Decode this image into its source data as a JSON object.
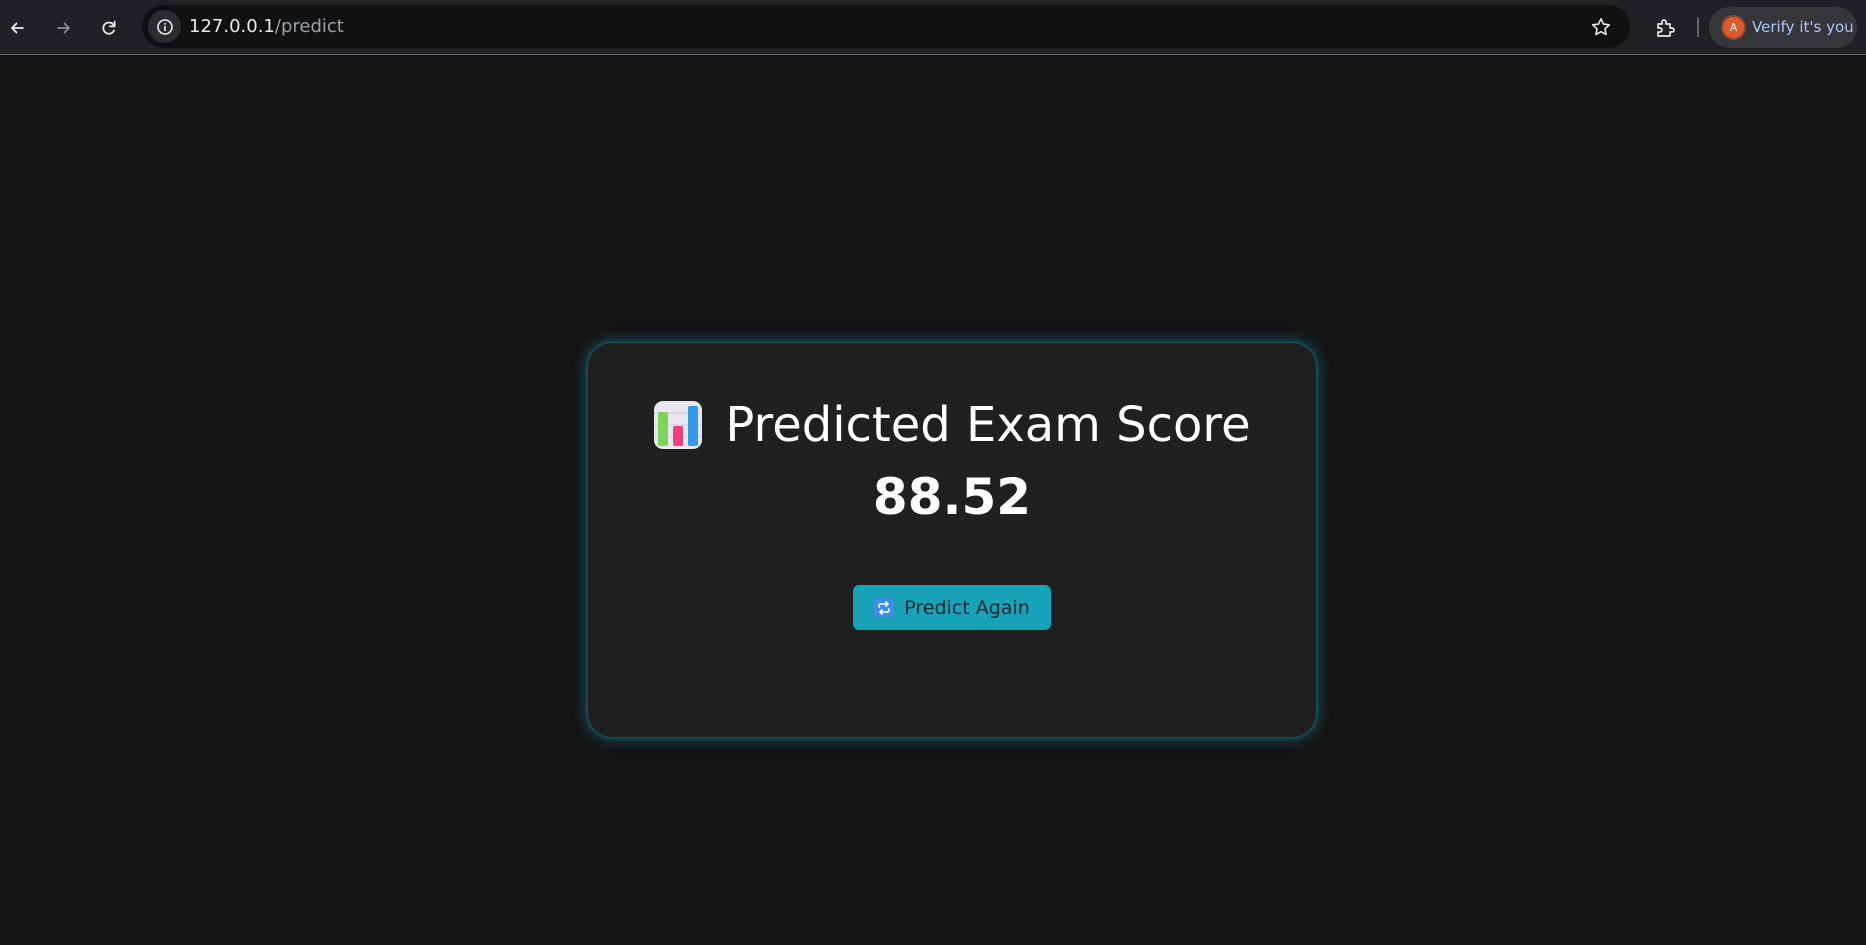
{
  "browser": {
    "url_host": "127.0.0.1",
    "url_path": "/predict",
    "profile_label": "Verify it's you",
    "profile_initial": "A",
    "icons": {
      "back": "back-arrow-icon",
      "forward": "forward-arrow-icon",
      "reload": "reload-icon",
      "site_info": "info-icon",
      "bookmark": "star-icon",
      "extensions": "puzzle-icon"
    }
  },
  "result": {
    "title": "Predicted Exam Score",
    "title_icon": "bar-chart-emoji-icon",
    "score": "88.52",
    "button_label": "Predict Again",
    "button_icon": "repeat-emoji-icon"
  },
  "colors": {
    "accent": "#17a2b8",
    "card_background": "#202020",
    "page_background": "#151515",
    "profile_text": "#a8c7fa",
    "avatar": "#e0582c"
  }
}
